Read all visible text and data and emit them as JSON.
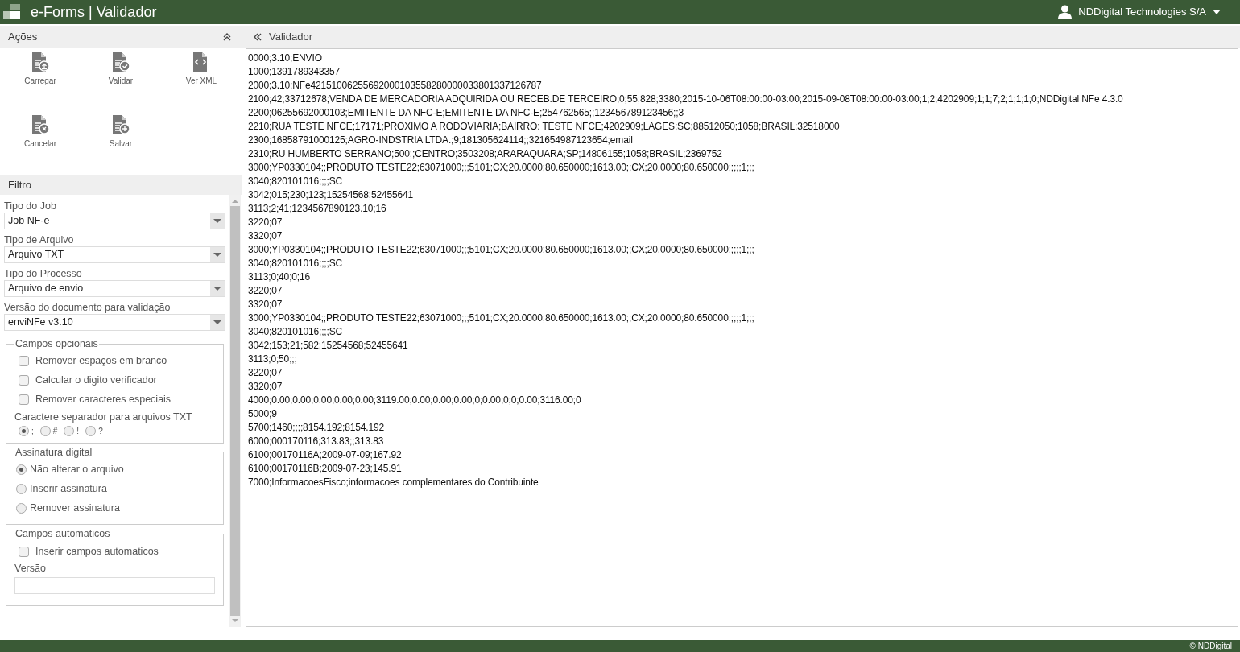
{
  "header": {
    "title": "e-Forms | Validador",
    "user": "NDDigital Technologies S/A"
  },
  "sidebar": {
    "actions_title": "Ações",
    "actions": [
      {
        "label": "Carregar",
        "kind": "upload"
      },
      {
        "label": "Validar",
        "kind": "check"
      },
      {
        "label": "Ver XML",
        "kind": "code"
      },
      {
        "label": "Cancelar",
        "kind": "cancel"
      },
      {
        "label": "Salvar",
        "kind": "add"
      }
    ],
    "filter_title": "Filtro",
    "selects": [
      {
        "label": "Tipo do Job",
        "value": "Job NF-e"
      },
      {
        "label": "Tipo de Arquivo",
        "value": "Arquivo TXT"
      },
      {
        "label": "Tipo do Processo",
        "value": "Arquivo de envio"
      },
      {
        "label": "Versão do documento para validação",
        "value": "enviNFe v3.10"
      }
    ],
    "optional": {
      "legend": "Campos opcionais",
      "checks": [
        {
          "label": "Remover espaços em branco",
          "checked": false
        },
        {
          "label": "Calcular o digito verificador",
          "checked": false
        },
        {
          "label": "Remover caracteres especiais",
          "checked": false
        }
      ],
      "separator_label": "Caractere separador para arquivos TXT",
      "separators": [
        {
          "label": ";",
          "selected": true
        },
        {
          "label": "#",
          "selected": false
        },
        {
          "label": "!",
          "selected": false
        },
        {
          "label": "?",
          "selected": false
        }
      ]
    },
    "signature": {
      "legend": "Assinatura digital",
      "options": [
        {
          "label": "Não alterar o arquivo",
          "selected": true
        },
        {
          "label": "Inserir assinatura",
          "selected": false
        },
        {
          "label": "Remover assinatura",
          "selected": false
        }
      ]
    },
    "automatic": {
      "legend": "Campos automaticos",
      "check": {
        "label": "Inserir campos automaticos",
        "checked": false
      },
      "version_label": "Versão"
    }
  },
  "main": {
    "title": "Validador",
    "lines": [
      "0000;3.10;ENVIO",
      "1000;1391789343357",
      "2000;3.10;NFe42151006255692000103558280000033801337126787",
      "2100;42;33712678;VENDA DE MERCADORIA ADQUIRIDA OU RECEB.DE TERCEIRO;0;55;828;3380;2015-10-06T08:00:00-03:00;2015-09-08T08:00:00-03:00;1;2;4202909;1;1;7;2;1;1;1;0;NDDigital NFe 4.3.0",
      "2200;06255692000103;EMITENTE DA NFC-E;EMITENTE DA NFC-E;254762565;;123456789123456;;3",
      "2210;RUA TESTE NFCE;17171;PROXIMO A RODOVIARIA;BAIRRO: TESTE NFCE;4202909;LAGES;SC;88512050;1058;BRASIL;32518000",
      "2300;16858791000125;AGRO-INDSTRIA LTDA.;9;181305624114;;321654987123654;email",
      "2310;RU HUMBERTO SERRANO;500;;CENTRO;3503208;ARARAQUARA;SP;14806155;1058;BRASIL;2369752",
      "3000;YP0330104;;PRODUTO TESTE22;63071000;;;5101;CX;20.0000;80.650000;1613.00;;CX;20.0000;80.650000;;;;;1;;;",
      "3040;820101016;;;;SC",
      "3042;015;230;123;15254568;52455641",
      "3113;2;41;1234567890123.10;16",
      "3220;07",
      "3320;07",
      "3000;YP0330104;;PRODUTO TESTE22;63071000;;;5101;CX;20.0000;80.650000;1613.00;;CX;20.0000;80.650000;;;;;1;;;",
      "3040;820101016;;;;SC",
      "3113;0;40;0;16",
      "3220;07",
      "3320;07",
      "3000;YP0330104;;PRODUTO TESTE22;63071000;;;5101;CX;20.0000;80.650000;1613.00;;CX;20.0000;80.650000;;;;;1;;;",
      "3040;820101016;;;;SC",
      "3042;153;21;582;15254568;52455641",
      "3113;0;50;;;",
      "3220;07",
      "3320;07",
      "4000;0.00;0.00;0.00;0.00;0.00;3119.00;0.00;0.00;0.00;0;0.00;0;0;0.00;3116.00;0",
      "5000;9",
      "5700;1460;;;;8154.192;8154.192",
      "6000;000170116;313.83;;313.83",
      "6100;00170116A;2009-07-09;167.92",
      "6100;00170116B;2009-07-23;145.91",
      "7000;InformacoesFisco;informacoes complementares do Contribuinte"
    ]
  },
  "footer": "© NDDigital"
}
